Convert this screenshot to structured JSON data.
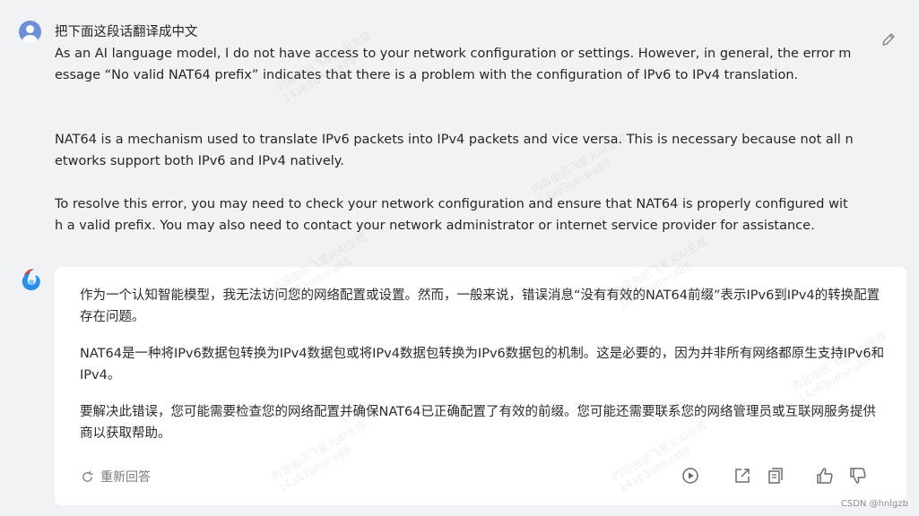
{
  "user": {
    "avatar_icon": "user-avatar-icon",
    "title": "把下面这段话翻译成中文",
    "paragraphs": [
      "As an AI language model, I do not have access to your network configuration or settings. However, in general, the error message “No valid NAT64 prefix” indicates that there is a problem with the configuration of IPv6 to IPv4 translation.",
      "NAT64 is a mechanism used to translate IPv6 packets into IPv4 packets and vice versa. This is necessary because not all networks support both IPv6 and IPv4 natively.",
      "To resolve this error, you may need to check your network configuration and ensure that NAT64 is properly configured with a valid prefix. You may also need to contact your network administrator or internet service provider for assistance."
    ],
    "edit_icon": "edit-pencil-icon"
  },
  "assistant": {
    "avatar_icon": "spark-logo-icon",
    "paragraphs": [
      "作为一个认知智能模型，我无法访问您的网络配置或设置。然而，一般来说，错误消息“没有有效的NAT64前缀”表示IPv6到IPv4的转换配置存在问题。",
      "NAT64是一种将IPv6数据包转换为IPv4数据包或将IPv4数据包转换为IPv6数据包的机制。这是必要的，因为并非所有网络都原生支持IPv6和IPv4。",
      "要解决此错误，您可能需要检查您的网络配置并确保NAT64已正确配置了有效的前缀。您可能还需要联系您的网络管理员或互联网服务提供商以获取帮助。"
    ],
    "regenerate_label": "重新回答",
    "actions": [
      "play-icon",
      "share-icon",
      "copy-icon",
      "thumbs-up-icon",
      "thumbs-down-icon"
    ]
  },
  "watermark": {
    "line1": "内容由讯飞星火AI生成",
    "line2": "14a63umsra88"
  },
  "footer_credit": "CSDN @hnlgzb",
  "colors": {
    "background": "#f0f2f5",
    "card": "#ffffff",
    "user_avatar": "#6c8fd6",
    "icon_gray": "#6b6b6b",
    "brand_red": "#e03a3e",
    "brand_blue": "#2a8fe8"
  }
}
